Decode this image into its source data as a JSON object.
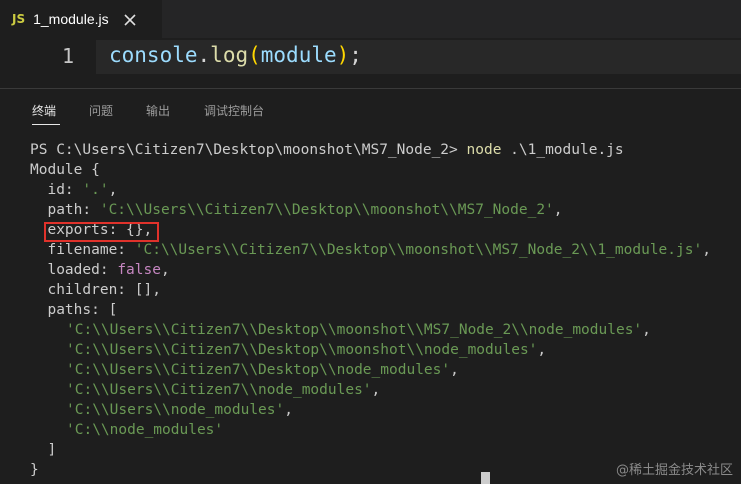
{
  "editor": {
    "tab": {
      "icon": "JS",
      "filename": "1_module.js"
    },
    "line_number": "1",
    "code": {
      "object": "console",
      "dot": ".",
      "method": "log",
      "open_paren": "(",
      "arg": "module",
      "close_paren": ")",
      "semicolon": ";"
    }
  },
  "panel": {
    "tabs": [
      {
        "label": "终端",
        "active": true
      },
      {
        "label": "问题",
        "active": false
      },
      {
        "label": "输出",
        "active": false
      },
      {
        "label": "调试控制台",
        "active": false
      }
    ]
  },
  "terminal": {
    "prompt": "PS C:\\Users\\Citizen7\\Desktop\\moonshot\\MS7_Node_2> ",
    "command": "node",
    "command_args": " .\\1_module.js",
    "module_open": "Module {",
    "id_key": "  id: ",
    "id_val": "'.'",
    "path_key": "  path: ",
    "path_val": "'C:\\\\Users\\\\Citizen7\\\\Desktop\\\\moonshot\\\\MS7_Node_2'",
    "exports_line": "  exports: {},",
    "filename_key": "  filename: ",
    "filename_val": "'C:\\\\Users\\\\Citizen7\\\\Desktop\\\\moonshot\\\\MS7_Node_2\\\\1_module.js'",
    "loaded_key": "  loaded: ",
    "loaded_val": "false",
    "children_line": "  children: [],",
    "paths_key": "  paths: [",
    "paths": [
      "'C:\\\\Users\\\\Citizen7\\\\Desktop\\\\moonshot\\\\MS7_Node_2\\\\node_modules'",
      "'C:\\\\Users\\\\Citizen7\\\\Desktop\\\\moonshot\\\\node_modules'",
      "'C:\\\\Users\\\\Citizen7\\\\Desktop\\\\node_modules'",
      "'C:\\\\Users\\\\Citizen7\\\\node_modules'",
      "'C:\\\\Users\\\\node_modules'",
      "'C:\\\\node_modules'"
    ],
    "paths_close": "  ]",
    "module_close": "}"
  },
  "watermark": "@稀土掘金技术社区",
  "colors": {
    "background": "#1e1e1e",
    "string": "#6a9955",
    "highlight_border": "#e0322b"
  }
}
